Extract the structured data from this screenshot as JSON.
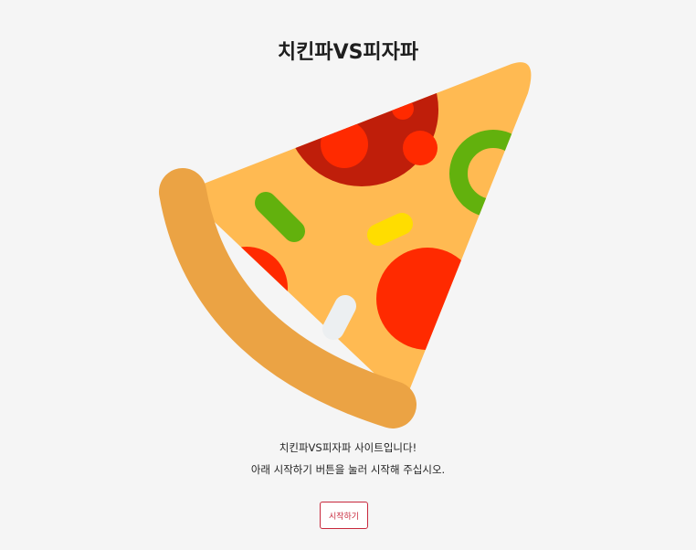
{
  "page": {
    "title": "치킨파VS피자파"
  },
  "hero_image": {
    "icon": "pizza-slice-icon"
  },
  "intro": {
    "line1": "치킨파VS피자파 사이트입니다!",
    "line2": "아래 시작하기 버튼을 눌러 시작해 주십시오."
  },
  "actions": {
    "start_label": "시작하기"
  },
  "colors": {
    "background": "#f5f5f5",
    "crust": "#eba344",
    "cheese": "#ffba52",
    "salami": "#bf1e0a",
    "tomato": "#ff2a00",
    "pepper": "#62b10d",
    "corn": "#ffdd00",
    "onion": "#eceff1",
    "accent": "#c8283c"
  }
}
